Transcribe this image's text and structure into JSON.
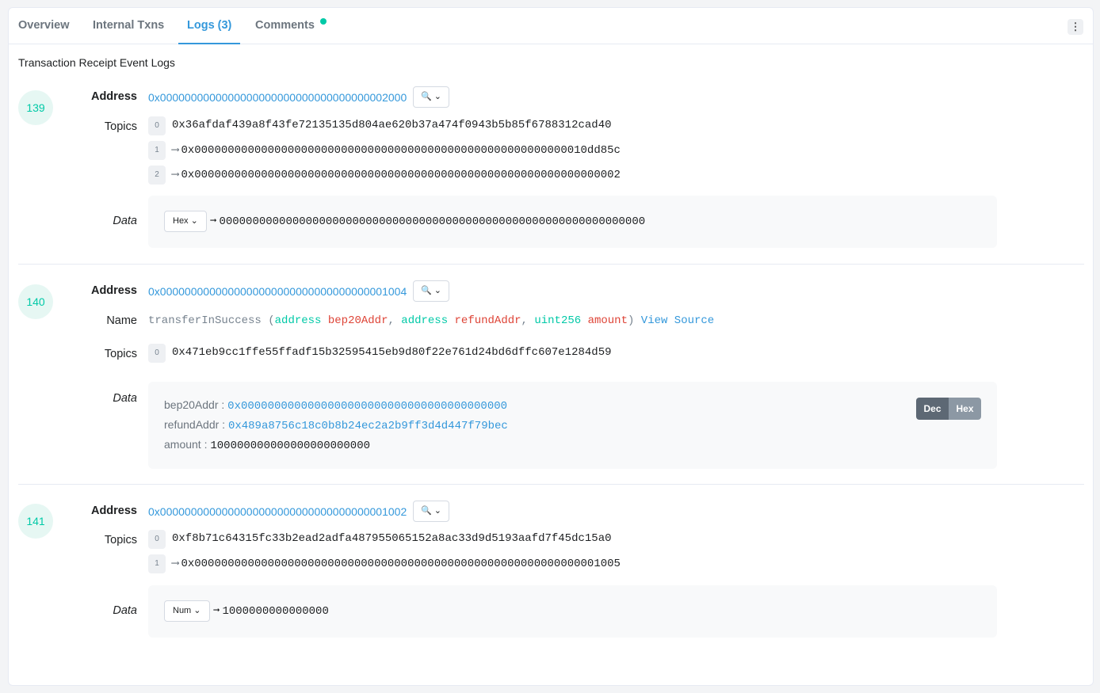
{
  "tabs": {
    "overview": "Overview",
    "internal": "Internal Txns",
    "logs": "Logs (3)",
    "comments": "Comments"
  },
  "menu_icon": "⋮",
  "section_title": "Transaction Receipt Event Logs",
  "labels": {
    "address": "Address",
    "topics": "Topics",
    "data": "Data",
    "name": "Name"
  },
  "search_icon": "🔍",
  "chevron": "⌄",
  "logs": [
    {
      "index": "139",
      "address": "0x0000000000000000000000000000000000002000",
      "topics": [
        {
          "n": "0",
          "v": "0x36afdaf439a8f43fe72135135d804ae620b37a474f0943b5b85f6788312cad40",
          "arrow": ""
        },
        {
          "n": "1",
          "v": "0x00000000000000000000000000000000000000000000000000000000010dd85c",
          "arrow": "⟶"
        },
        {
          "n": "2",
          "v": "0x0000000000000000000000000000000000000000000000000000000000000002",
          "arrow": "⟶"
        }
      ],
      "data_format": "Hex",
      "data_value": "0000000000000000000000000000000000000000000000000000000000000000"
    },
    {
      "index": "140",
      "address": "0x0000000000000000000000000000000000001004",
      "name": {
        "fn": "transferInSuccess",
        "open": " (",
        "t1": "address",
        "p1": "bep20Addr",
        "t2": "address",
        "p2": "refundAddr",
        "t3": "uint256",
        "p3": "amount",
        "close": ")",
        "comma": ", ",
        "view_source": "View Source"
      },
      "topics": [
        {
          "n": "0",
          "v": "0x471eb9cc1ffe55ffadf15b32595415eb9d80f22e761d24bd6dffc607e1284d59",
          "arrow": ""
        }
      ],
      "decoded": [
        {
          "k": "bep20Addr : ",
          "v": "0x0000000000000000000000000000000000000000"
        },
        {
          "k": "refundAddr : ",
          "v": "0x489a8756c18c0b8b24ec2a2b9ff3d4d447f79bec"
        },
        {
          "k": "amount : ",
          "v": "100000000000000000000000"
        }
      ],
      "toggle": {
        "dec": "Dec",
        "hex": "Hex"
      }
    },
    {
      "index": "141",
      "address": "0x0000000000000000000000000000000000001002",
      "topics": [
        {
          "n": "0",
          "v": "0xf8b71c64315fc33b2ead2adfa487955065152a8ac33d9d5193aafd7f45dc15a0",
          "arrow": ""
        },
        {
          "n": "1",
          "v": "0x0000000000000000000000000000000000000000000000000000000000001005",
          "arrow": "⟶"
        }
      ],
      "data_format": "Num",
      "data_value": "1000000000000000"
    }
  ],
  "colors": {
    "accent": "#3498db",
    "teal": "#00c9a7",
    "red": "#de4437"
  }
}
